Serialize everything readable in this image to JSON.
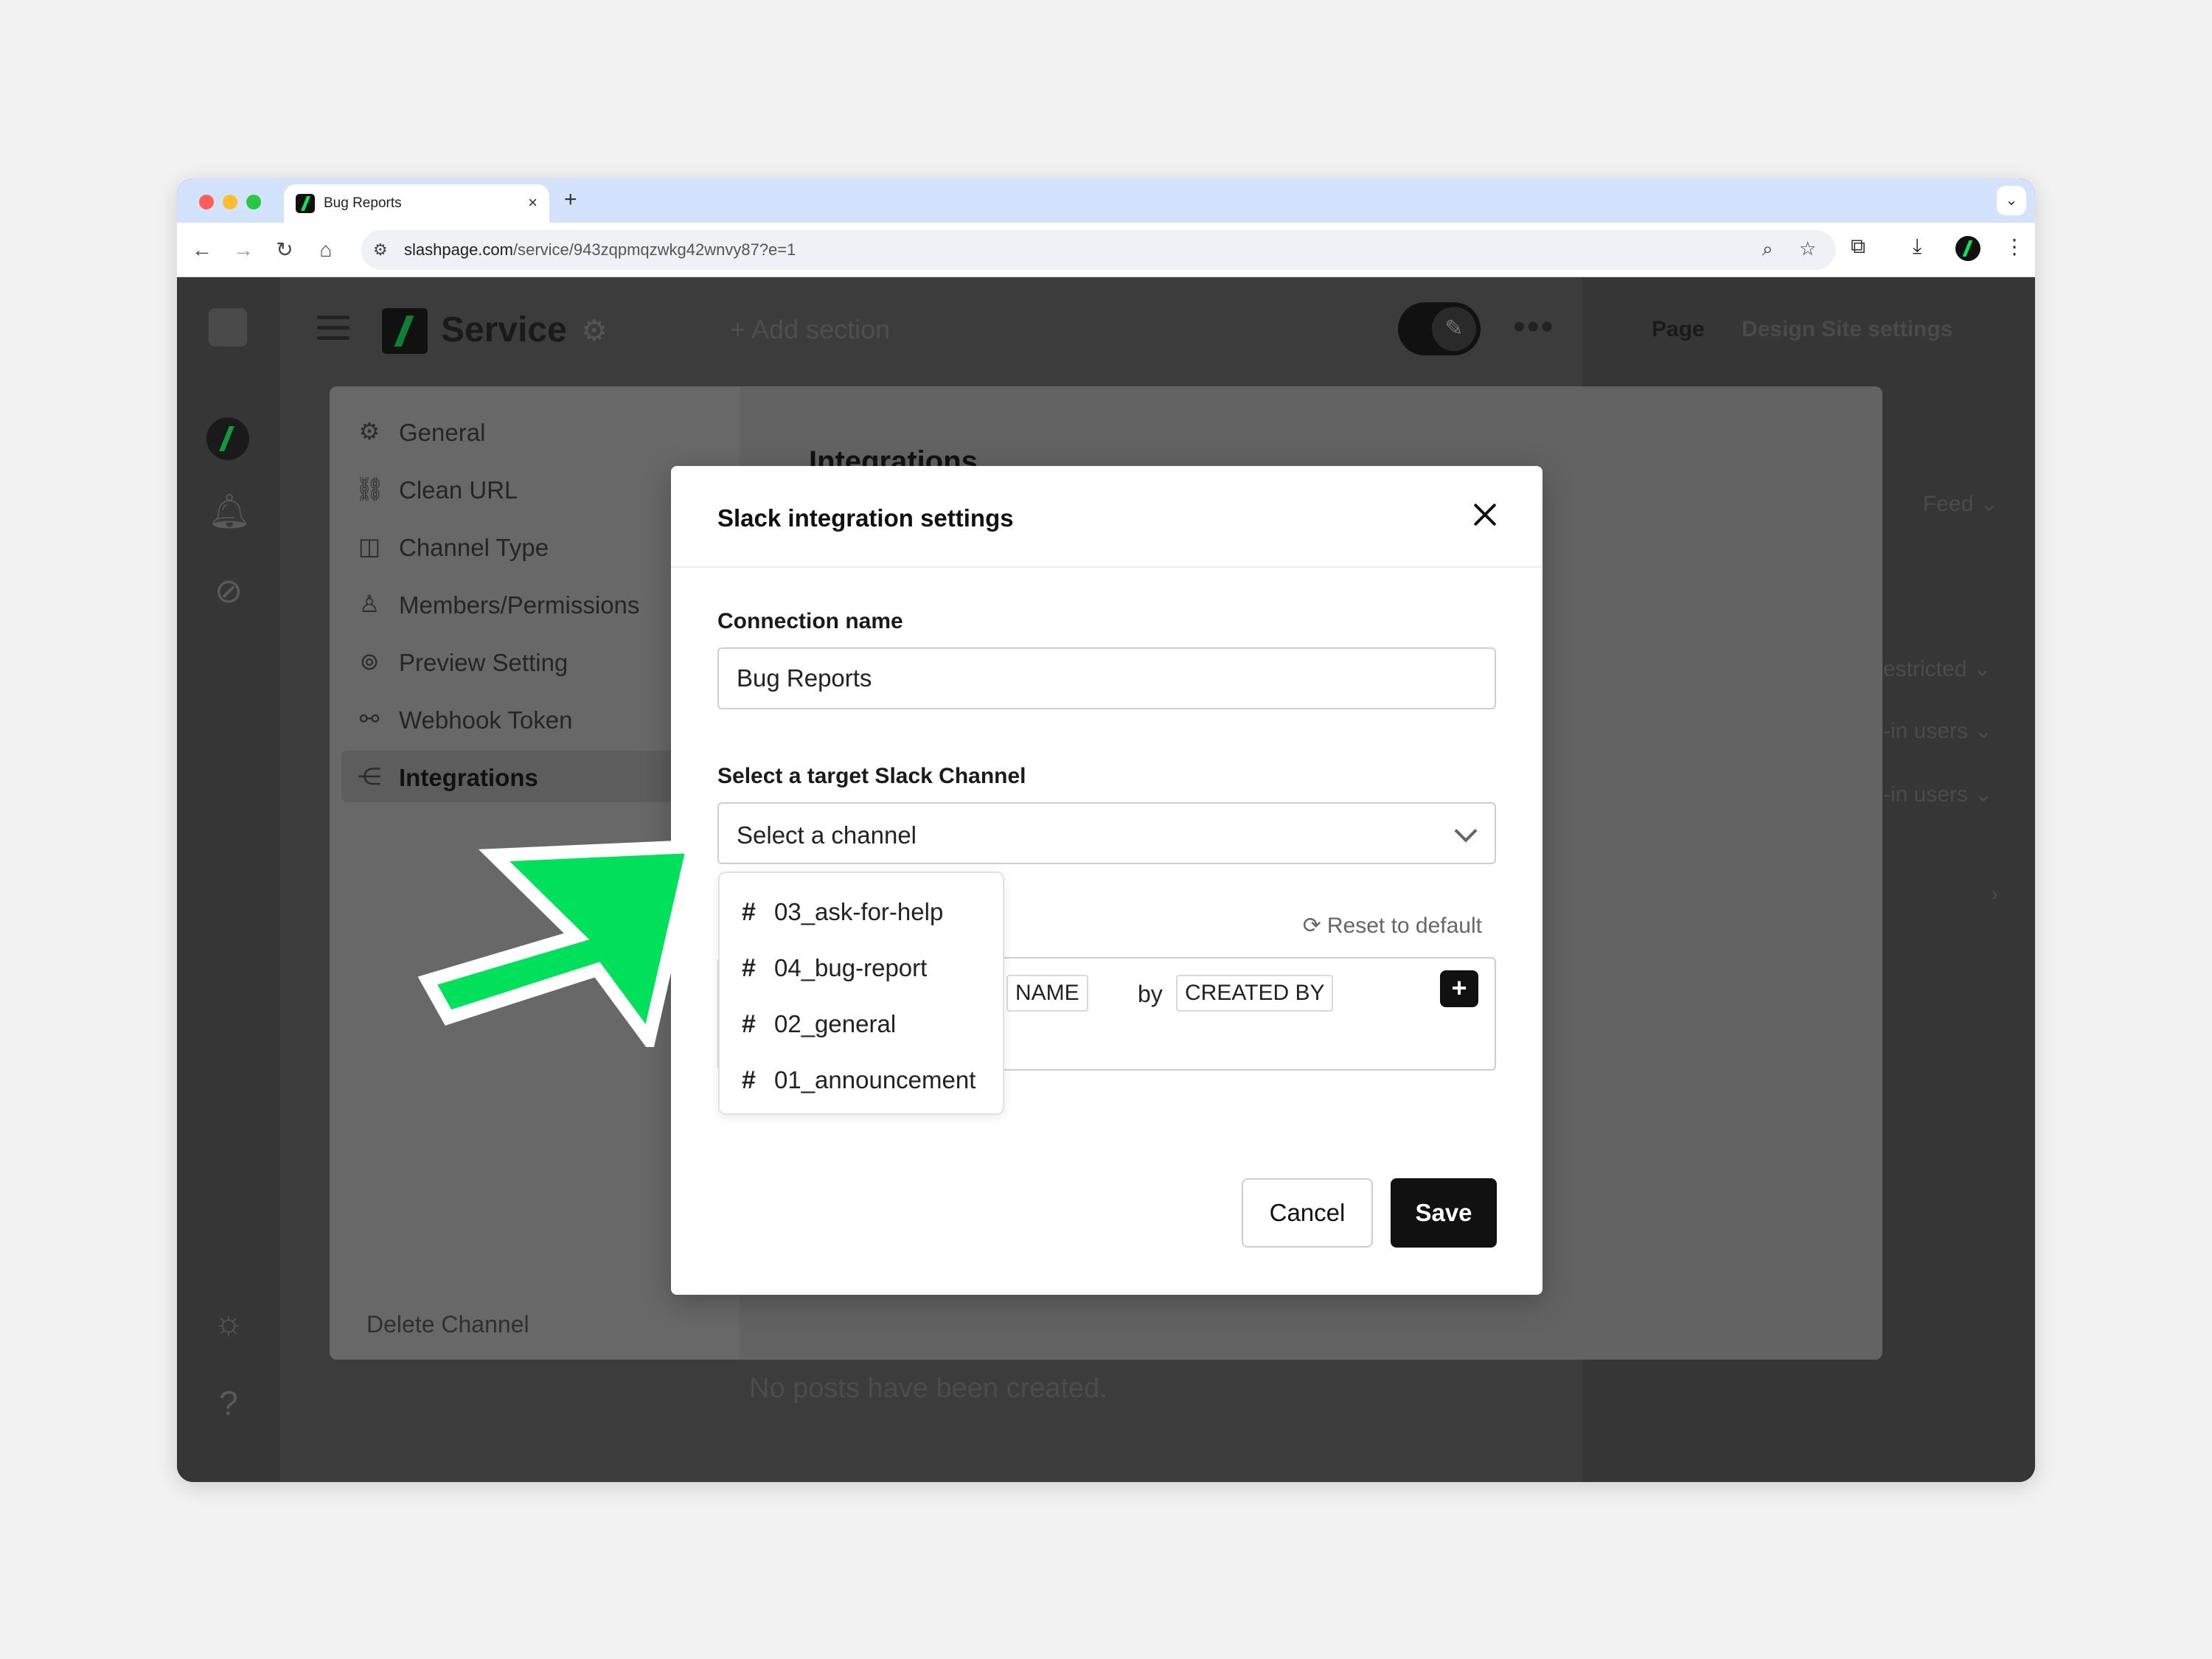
{
  "browser": {
    "tab_title": "Bug Reports",
    "tab_close": "×",
    "new_tab": "+",
    "url_domain": "slashpage.com",
    "url_path": "/service/943zqpmqzwkg42wnvy87?e=1"
  },
  "app": {
    "service_title": "Service",
    "add_section": "+ Add section",
    "more": "•••",
    "right_tabs": [
      "Page",
      "Design",
      "Site settings"
    ],
    "right_items": [
      "Feed ⌄",
      "estricted ⌄",
      "-in users ⌄",
      "-in users ⌄",
      "›"
    ],
    "no_posts": "No posts have been created."
  },
  "settings": {
    "menu": [
      {
        "label": "General",
        "icon": "gear-icon"
      },
      {
        "label": "Clean URL",
        "icon": "link-icon"
      },
      {
        "label": "Channel Type",
        "icon": "layout-icon"
      },
      {
        "label": "Members/Permissions",
        "icon": "person-icon"
      },
      {
        "label": "Preview Setting",
        "icon": "preview-icon"
      },
      {
        "label": "Webhook Token",
        "icon": "webhook-icon"
      },
      {
        "label": "Integrations",
        "icon": "integrations-icon"
      }
    ],
    "active_item": "Integrations",
    "delete_channel": "Delete Channel",
    "heading": "Integrations"
  },
  "modal": {
    "title": "Slack integration settings",
    "connection_label": "Connection name",
    "connection_value": "Bug Reports",
    "channel_label": "Select a target Slack Channel",
    "channel_placeholder": "Select a channel",
    "channels": [
      "03_ask-for-help",
      "04_bug-report",
      "02_general",
      "01_announcement"
    ],
    "reset_label": "Reset to default",
    "template_chips": [
      "NAME",
      "CREATED BY"
    ],
    "template_by": "by",
    "plus": "+",
    "cancel": "Cancel",
    "save": "Save"
  },
  "colors": {
    "accent_green": "#00e05a",
    "save_button": "#111111"
  }
}
